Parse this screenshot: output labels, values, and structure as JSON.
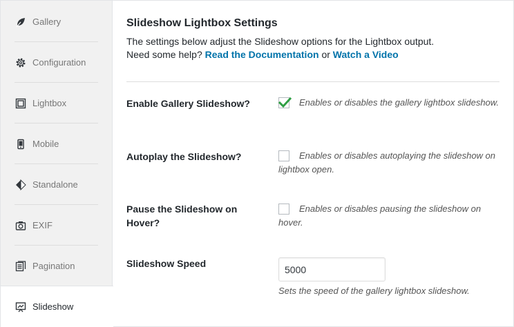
{
  "sidebar": {
    "items": [
      {
        "label": "Gallery",
        "icon": "leaf-icon"
      },
      {
        "label": "Configuration",
        "icon": "gear-icon"
      },
      {
        "label": "Lightbox",
        "icon": "lightbox-icon"
      },
      {
        "label": "Mobile",
        "icon": "mobile-icon"
      },
      {
        "label": "Standalone",
        "icon": "standalone-icon"
      },
      {
        "label": "EXIF",
        "icon": "camera-icon"
      },
      {
        "label": "Pagination",
        "icon": "pagination-icon"
      },
      {
        "label": "Slideshow",
        "icon": "slideshow-icon"
      }
    ],
    "active": "Slideshow"
  },
  "main": {
    "title": "Slideshow Lightbox Settings",
    "desc_line1": "The settings below adjust the Slideshow options for the Lightbox output.",
    "desc_line2_prefix": "Need some help?",
    "docs_link": "Read the Documentation",
    "or_text": "or",
    "video_link": "Watch a Video",
    "settings": {
      "enable": {
        "label": "Enable Gallery Slideshow?",
        "checked": true,
        "help": "Enables or disables the gallery lightbox slideshow."
      },
      "autoplay": {
        "label": "Autoplay the Slideshow?",
        "checked": false,
        "help": "Enables or disables autoplaying the slideshow on lightbox open."
      },
      "pause": {
        "label": "Pause the Slideshow on Hover?",
        "checked": false,
        "help": "Enables or disables pausing the slideshow on hover."
      },
      "speed": {
        "label": "Slideshow Speed",
        "value": "5000",
        "help": "Sets the speed of the gallery lightbox slideshow."
      }
    }
  },
  "colors": {
    "link": "#0073aa",
    "check": "#1e8cbe",
    "sidebar_bg": "#f1f1f1"
  }
}
